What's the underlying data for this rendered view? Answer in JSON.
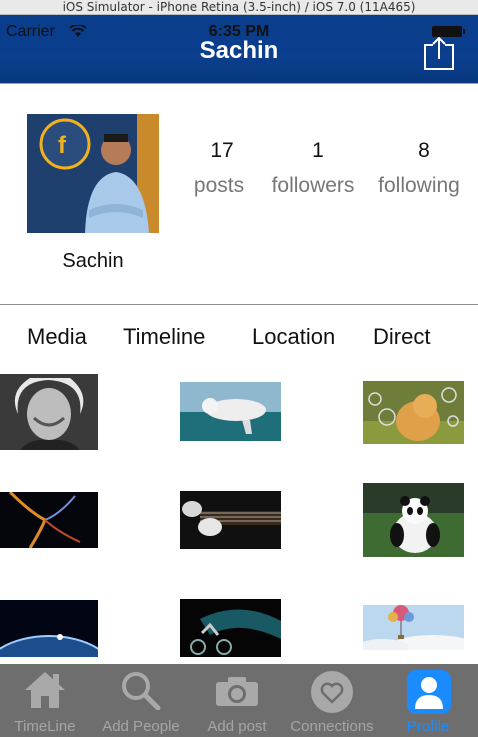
{
  "simulator_title": "iOS Simulator - iPhone Retina (3.5-inch) / iOS 7.0 (11A465)",
  "status": {
    "carrier": "Carrier",
    "time": "6:35 PM"
  },
  "nav": {
    "title": "Sachin"
  },
  "profile": {
    "name": "Sachin",
    "stats": [
      {
        "value": "17",
        "label": "posts"
      },
      {
        "value": "1",
        "label": "followers"
      },
      {
        "value": "8",
        "label": "following"
      }
    ]
  },
  "segments": [
    "Media",
    "Timeline",
    "Location",
    "Direct"
  ],
  "tabbar": {
    "items": [
      {
        "label": "TimeLine",
        "icon": "home-icon"
      },
      {
        "label": "Add People",
        "icon": "search-icon"
      },
      {
        "label": "Add post",
        "icon": "camera-icon"
      },
      {
        "label": "Connections",
        "icon": "heart-icon"
      },
      {
        "label": "Profile",
        "icon": "person-icon",
        "active": true
      }
    ]
  },
  "colors": {
    "nav_bar": "#0b3f8f",
    "tab_bar": "#6e6e6e",
    "active_tab": "#1a8cff"
  }
}
